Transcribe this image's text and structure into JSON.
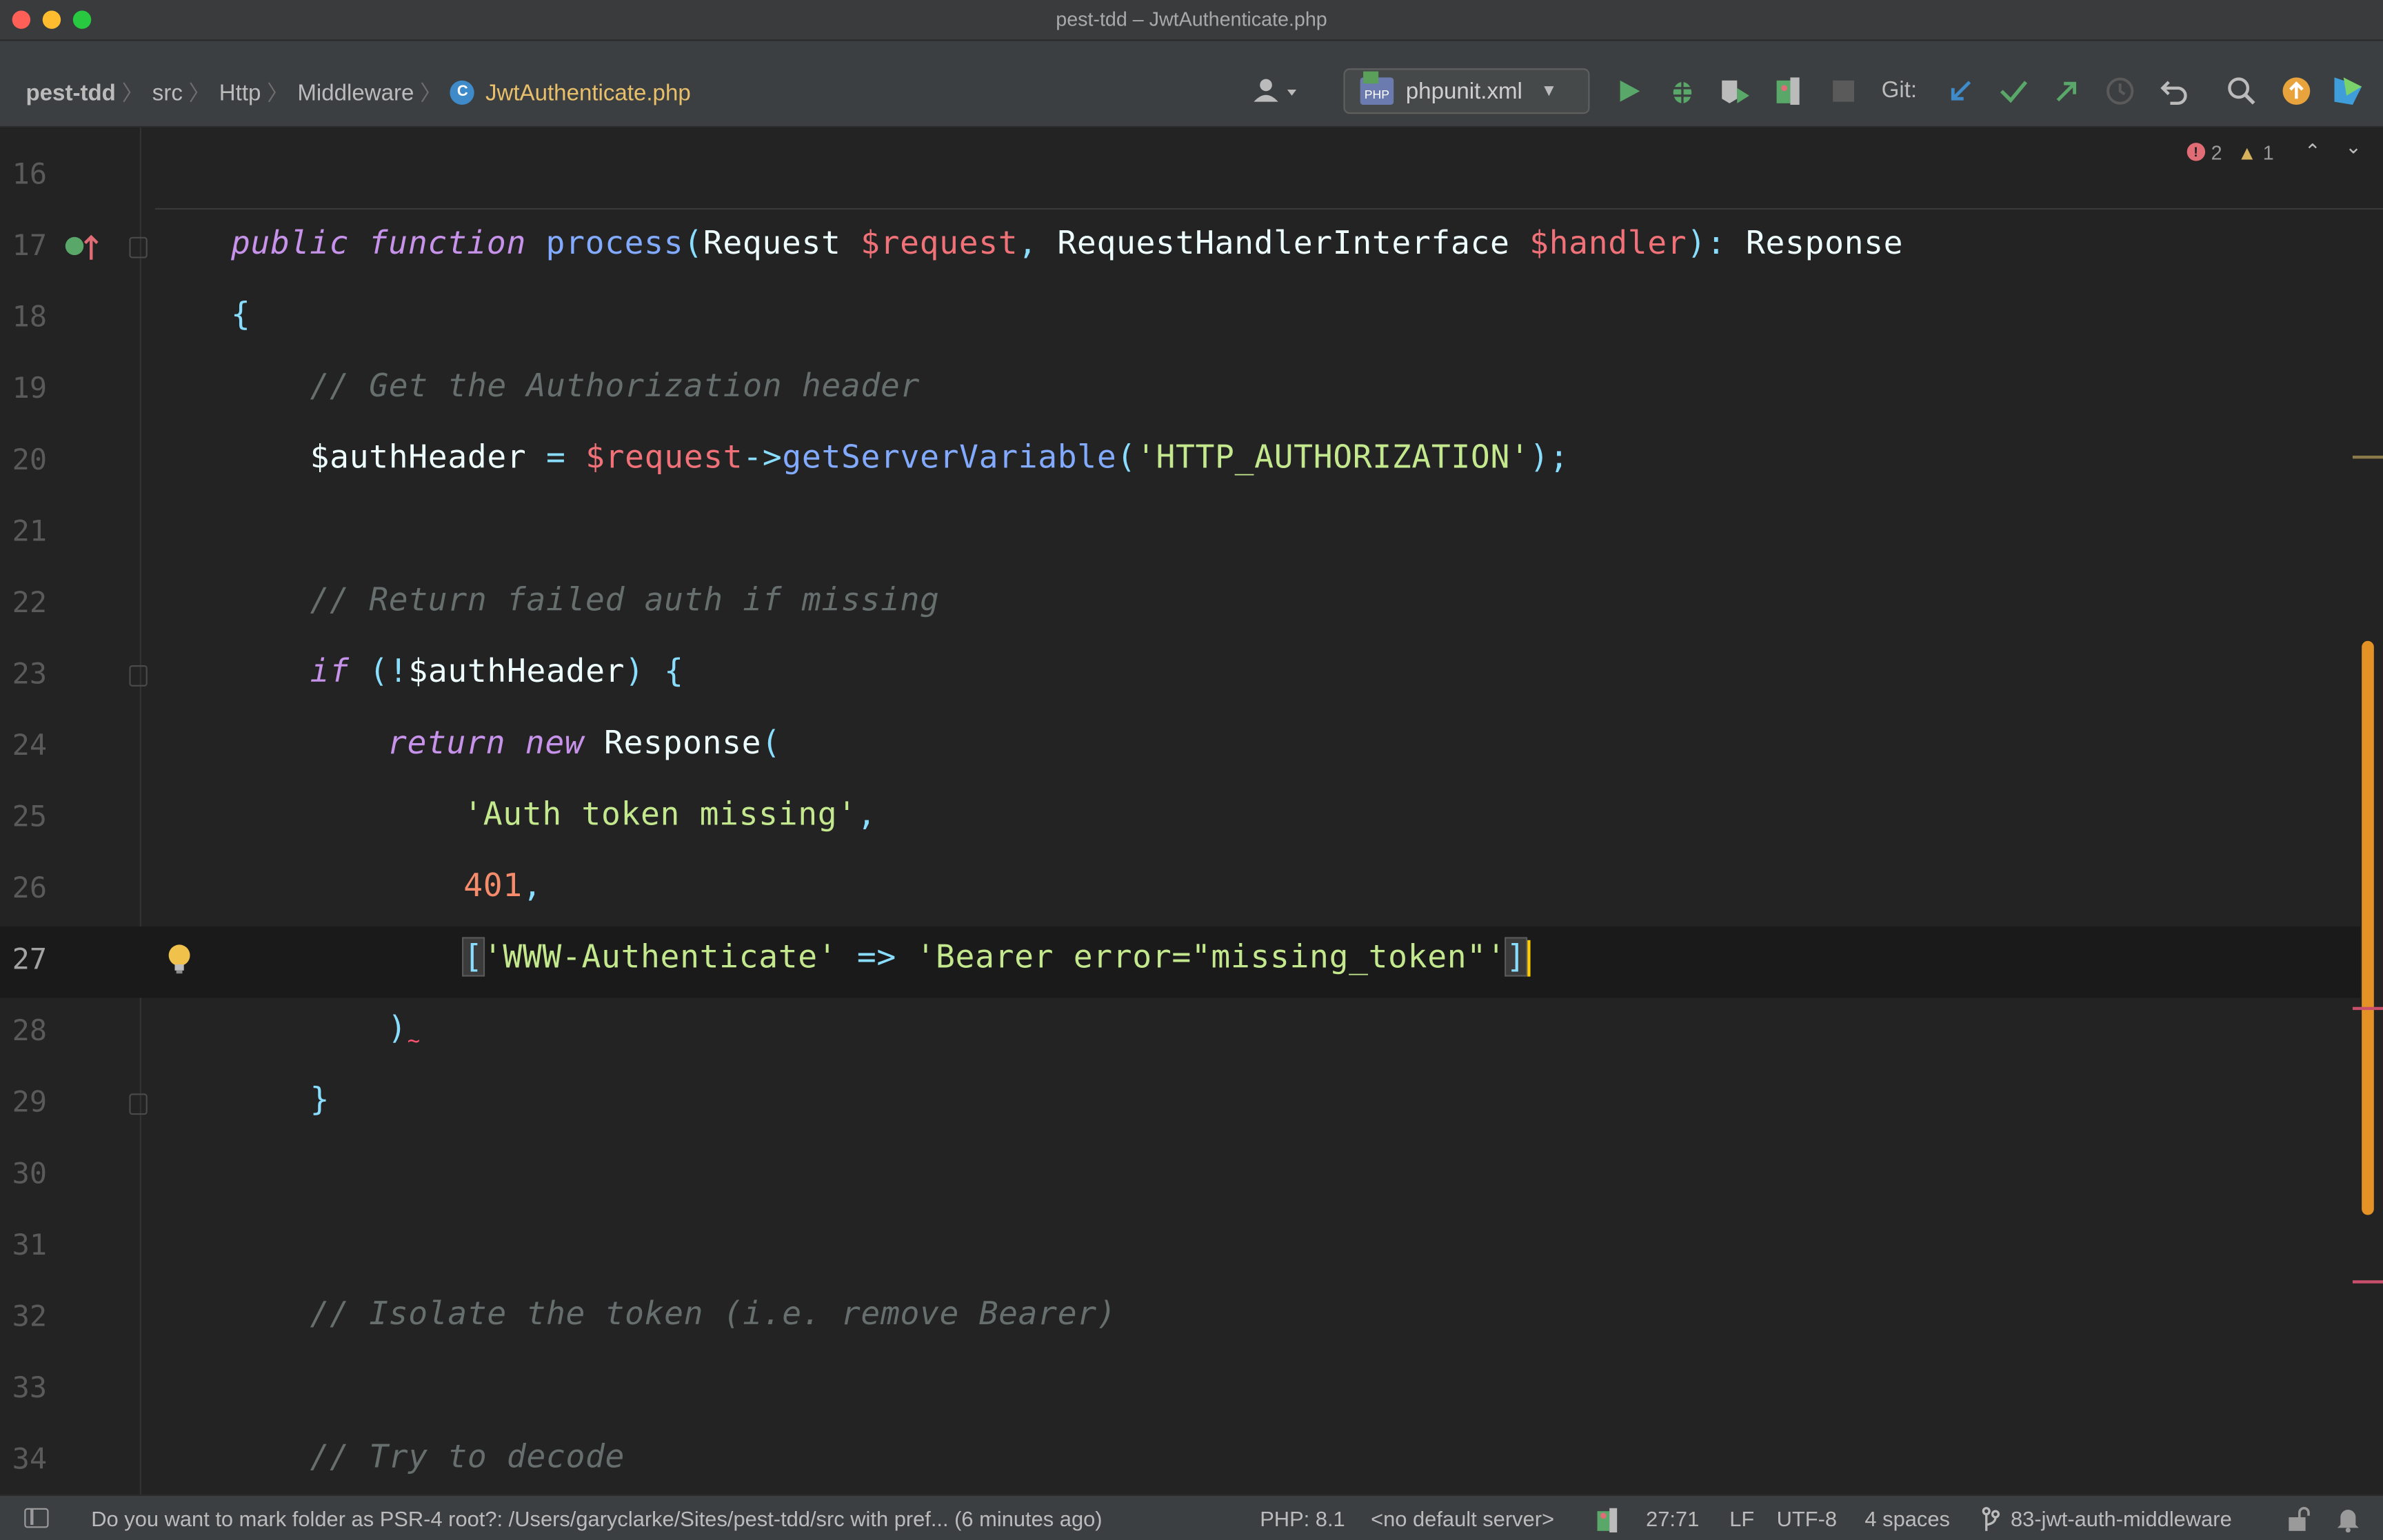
{
  "window": {
    "title": "pest-tdd – JwtAuthenticate.php"
  },
  "breadcrumb": {
    "items": [
      "pest-tdd",
      "src",
      "Http",
      "Middleware"
    ],
    "file_icon": "C",
    "file": "JwtAuthenticate.php"
  },
  "toolbar": {
    "run_config": "phpunit.xml",
    "git_label": "Git:",
    "icons": [
      "user-dropdown-icon",
      "run-icon",
      "debug-icon",
      "coverage-icon",
      "profile-icon",
      "stop-icon",
      "git-update-icon",
      "git-commit-icon",
      "git-push-icon",
      "history-icon",
      "rollback-icon",
      "search-icon",
      "update-available-icon",
      "ide-logo-icon"
    ]
  },
  "inspections": {
    "errors": "2",
    "warnings": "1"
  },
  "editor": {
    "current_line": "27",
    "lines": [
      {
        "n": "16"
      },
      {
        "n": "17"
      },
      {
        "n": "18"
      },
      {
        "n": "19"
      },
      {
        "n": "20"
      },
      {
        "n": "21"
      },
      {
        "n": "22"
      },
      {
        "n": "23"
      },
      {
        "n": "24"
      },
      {
        "n": "25"
      },
      {
        "n": "26"
      },
      {
        "n": "27"
      },
      {
        "n": "28"
      },
      {
        "n": "29"
      },
      {
        "n": "30"
      },
      {
        "n": "31"
      },
      {
        "n": "32"
      },
      {
        "n": "33"
      },
      {
        "n": "34"
      }
    ],
    "code": {
      "l17": {
        "kw1": "public",
        "kw2": "function",
        "fn": "process",
        "p1": "(",
        "t1": "Request",
        "v1": "$request",
        "c1": ",",
        "t2": "RequestHandlerInterface",
        "v2": "$handler",
        "p2": "):",
        "ret": "Response"
      },
      "l18": {
        "brace": "{"
      },
      "l19": {
        "comment": "// Get the Authorization header"
      },
      "l20": {
        "var": "$authHeader",
        "op": "=",
        "v": "$request",
        "arrow": "->",
        "fn": "getServerVariable",
        "p1": "(",
        "str": "'HTTP_AUTHORIZATION'",
        "p2": ");"
      },
      "l22": {
        "comment": "// Return failed auth if missing"
      },
      "l23": {
        "kw": "if",
        "p1": "(!",
        "var": "$authHeader",
        "p2": ") {"
      },
      "l24": {
        "kw1": "return",
        "kw2": "new",
        "cls": "Response",
        "p": "("
      },
      "l25": {
        "str": "'Auth token missing'",
        "c": ","
      },
      "l26": {
        "num": "401",
        "c": ","
      },
      "l27": {
        "b1": "[",
        "s1": "'WWW-Authenticate'",
        "op": "=>",
        "s2": "'Bearer error=\"missing_token\"'",
        "b2": "]"
      },
      "l28": {
        "p": ")"
      },
      "l29": {
        "brace": "}"
      },
      "l32": {
        "comment": "// Isolate the token (i.e. remove Bearer)"
      },
      "l34": {
        "comment": "// Try to decode"
      }
    }
  },
  "statusbar": {
    "message": "Do you want to mark folder as PSR-4 root?: /Users/garyclarke/Sites/pest-tdd/src with pref... (6 minutes ago)",
    "php_version": "PHP: 8.1",
    "server": "<no default server>",
    "position": "27:71",
    "line_ending": "LF",
    "encoding": "UTF-8",
    "indent": "4 spaces",
    "branch": "83-jwt-auth-middleware"
  },
  "colors": {
    "keyword": "#c792ea",
    "function": "#82aaff",
    "variable": "#f07178",
    "string": "#c3e88d",
    "number": "#f78c6c",
    "comment": "#676e6e",
    "scrollbar_accent": "#e49226"
  }
}
